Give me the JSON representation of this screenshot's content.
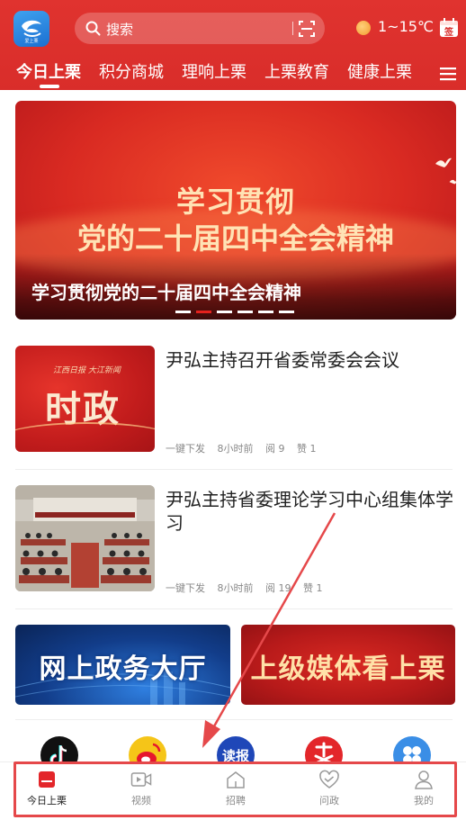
{
  "header": {
    "search_placeholder": "搜索",
    "weather_text": "1~15℃",
    "calendar_label": "签",
    "logo_caption": "爱上栗"
  },
  "tabs": [
    {
      "label": "今日上栗",
      "active": true
    },
    {
      "label": "积分商城",
      "active": false
    },
    {
      "label": "理响上栗",
      "active": false
    },
    {
      "label": "上栗教育",
      "active": false
    },
    {
      "label": "健康上栗",
      "active": false
    }
  ],
  "banner": {
    "line1": "学习贯彻",
    "line2": "党的二十届四中全会精神",
    "caption": "学习贯彻党的二十届四中全会精神",
    "dot_count": 6,
    "active_dot": 1
  },
  "news": [
    {
      "title": "尹弘主持召开省委常委会会议",
      "source": "一键下发",
      "time": "8小时前",
      "reads": "阅 9",
      "likes": "赞 1",
      "thumb_text": "时政",
      "thumb_small": "江西日报 大江新闻"
    },
    {
      "title": "尹弘主持省委理论学习中心组集体学习",
      "source": "一键下发",
      "time": "8小时前",
      "reads": "阅 19",
      "likes": "赞 1"
    }
  ],
  "promos": {
    "left": "网上政务大厅",
    "right": "上级媒体看上栗"
  },
  "shortcuts": [
    {
      "icon": "douyin-icon",
      "color": "#111111"
    },
    {
      "icon": "weibo-icon",
      "color": "#f5c518"
    },
    {
      "icon": "dubao-icon",
      "color": "#1f47b8",
      "label": "读报"
    },
    {
      "icon": "plus-red-icon",
      "color": "#e3262a"
    },
    {
      "icon": "apps-icon",
      "color": "#3a8ee6"
    }
  ],
  "bottom_nav": [
    {
      "label": "今日上栗",
      "icon": "home-icon",
      "active": true
    },
    {
      "label": "视频",
      "icon": "video-icon",
      "active": false
    },
    {
      "label": "招聘",
      "icon": "recruit-icon",
      "active": false
    },
    {
      "label": "问政",
      "icon": "heart-icon",
      "active": false
    },
    {
      "label": "我的",
      "icon": "user-icon",
      "active": false
    }
  ],
  "colors": {
    "brand_red": "#d92d2a",
    "annotation_red": "#e5484a"
  }
}
